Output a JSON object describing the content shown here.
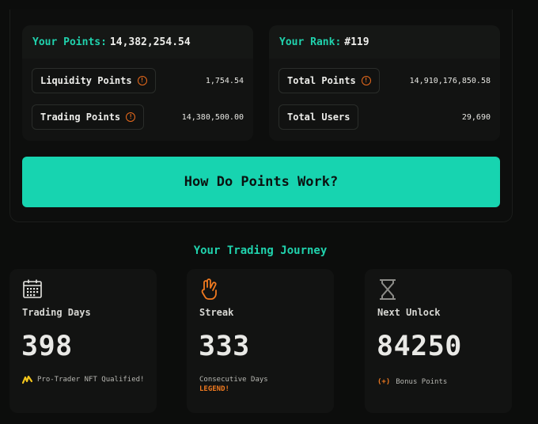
{
  "points_card": {
    "label": "Your Points:",
    "value": "14,382,254.54",
    "rows": [
      {
        "label": "Liquidity Points",
        "value": "1,754.54"
      },
      {
        "label": "Trading Points",
        "value": "14,380,500.00"
      }
    ]
  },
  "rank_card": {
    "label": "Your Rank:",
    "value": "#119",
    "rows": [
      {
        "label": "Total Points",
        "value": "14,910,176,850.58"
      },
      {
        "label": "Total Users",
        "value": "29,690"
      }
    ]
  },
  "cta": {
    "label": "How Do Points Work?"
  },
  "journey": {
    "title": "Your Trading Journey",
    "stats": [
      {
        "label": "Trading Days",
        "value": "398",
        "note": "Pro-Trader NFT Qualified!",
        "icon": "calendar-icon"
      },
      {
        "label": "Streak",
        "value": "333",
        "note": "Consecutive Days",
        "highlight": "LEGEND!",
        "icon": "peace-hand-icon"
      },
      {
        "label": "Next Unlock",
        "value": "84250",
        "badge": "(+)",
        "note": "Bonus Points",
        "icon": "hourglass-icon"
      }
    ]
  },
  "colors": {
    "accent": "#17d4b0",
    "warning": "#e86a1c",
    "nft": "#f2c51c",
    "background": "#0c0d0c"
  }
}
